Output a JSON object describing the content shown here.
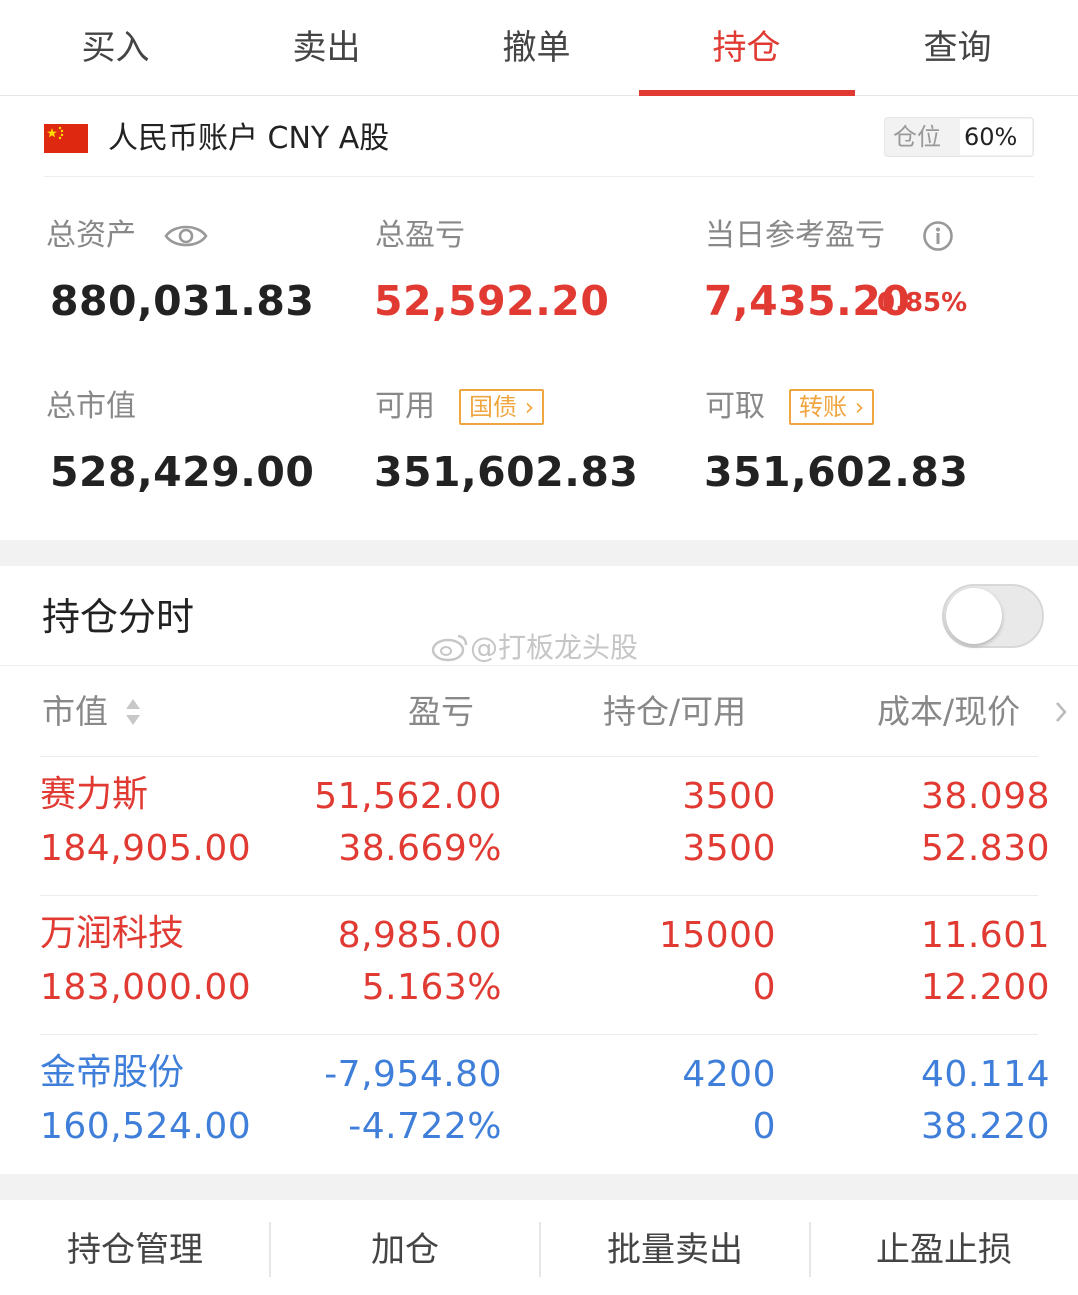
{
  "tabs": [
    {
      "label": "买入"
    },
    {
      "label": "卖出"
    },
    {
      "label": "撤单"
    },
    {
      "label": "持仓",
      "active": true
    },
    {
      "label": "查询"
    }
  ],
  "account": {
    "flag_icon": "china-flag-icon",
    "name": "人民币账户 CNY A股",
    "position_label": "仓位",
    "position_value": "60%"
  },
  "stats": {
    "total_assets": {
      "label": "总资产",
      "value": "880,031.83"
    },
    "total_pnl": {
      "label": "总盈亏",
      "value": "52,592.20"
    },
    "daily_pnl": {
      "label": "当日参考盈亏",
      "value": "7,435.20",
      "percent": "0.85%"
    },
    "market_value": {
      "label": "总市值",
      "value": "528,429.00"
    },
    "available": {
      "label": "可用",
      "value": "351,602.83",
      "tag": "国债"
    },
    "withdrawable": {
      "label": "可取",
      "value": "351,602.83",
      "tag": "转账"
    }
  },
  "section": {
    "title": "持仓分时",
    "toggle_on": false,
    "watermark": "@打板龙头股"
  },
  "table": {
    "headers": {
      "market_value": "市值",
      "pnl": "盈亏",
      "holding": "持仓/可用",
      "cost_price": "成本/现价"
    },
    "rows": [
      {
        "name": "赛力斯",
        "market_value": "184,905.00",
        "pnl": "51,562.00",
        "pnl_pct": "38.669%",
        "holding": "3500",
        "available": "3500",
        "cost": "38.098",
        "price": "52.830",
        "trend": "up"
      },
      {
        "name": "万润科技",
        "market_value": "183,000.00",
        "pnl": "8,985.00",
        "pnl_pct": "5.163%",
        "holding": "15000",
        "available": "0",
        "cost": "11.601",
        "price": "12.200",
        "trend": "up"
      },
      {
        "name": "金帝股份",
        "market_value": "160,524.00",
        "pnl": "-7,954.80",
        "pnl_pct": "-4.722%",
        "holding": "4200",
        "available": "0",
        "cost": "40.114",
        "price": "38.220",
        "trend": "down"
      }
    ]
  },
  "bottom_bar": [
    {
      "label": "持仓管理"
    },
    {
      "label": "加仓"
    },
    {
      "label": "批量卖出"
    },
    {
      "label": "止盈止损"
    }
  ],
  "colors": {
    "accent_red": "#e03a33",
    "down_blue": "#3f7fd9",
    "tag_orange": "#f0a640"
  }
}
